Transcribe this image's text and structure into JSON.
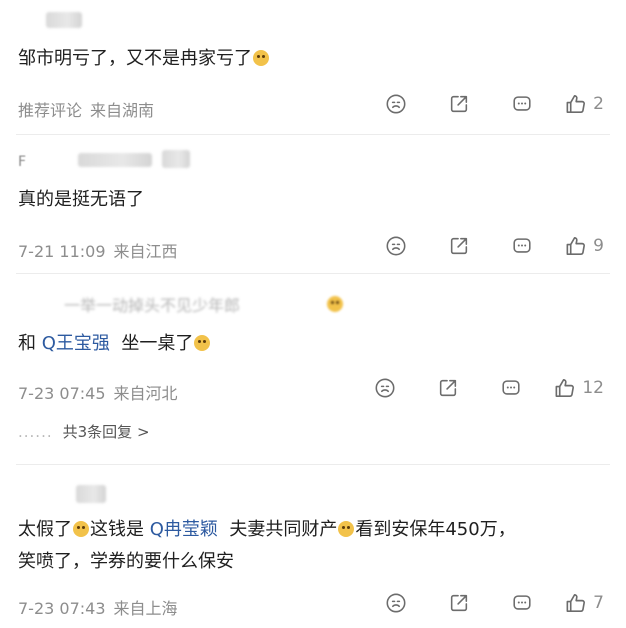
{
  "comments": [
    {
      "username": "",
      "text_parts": [
        "邹市明亏了，又不是冉家亏了"
      ],
      "tag": "推荐评论",
      "time": "",
      "location": "来自湖南",
      "likes": "2"
    },
    {
      "username": "F",
      "text_parts": [
        "真的是挺无语了"
      ],
      "tag": "",
      "time": "7-21 11:09",
      "location": "来自江西",
      "likes": "9"
    },
    {
      "username": "",
      "reply_preview": "一举一动掉头不见少年郎",
      "text_before": "和",
      "mention": "Q王宝强",
      "text_after": "坐一桌了",
      "tag": "",
      "time": "7-23 07:45",
      "location": "来自河北",
      "likes": "12",
      "replies_label": "共3条回复",
      "replies_arrow": ">",
      "replies_dots": "......"
    },
    {
      "username": "",
      "line1_a": "太假了",
      "line1_b": "这钱是",
      "mention": "Q冉莹颖",
      "line1_c": "夫妻共同财产",
      "line1_d": "看到安保年450万，",
      "line2": "笑喷了，学券的要什么保安",
      "tag": "",
      "time": "7-23 07:43",
      "location": "来自上海",
      "likes": "7"
    }
  ],
  "icons": {
    "emoji": "smiley-face-icon",
    "share": "share-icon",
    "comment": "comment-icon",
    "like": "thumbs-up-icon"
  },
  "colors": {
    "text": "#1f1f1f",
    "meta": "#8d8d8d",
    "mention": "#2d5aa0",
    "divider": "#ececec"
  }
}
